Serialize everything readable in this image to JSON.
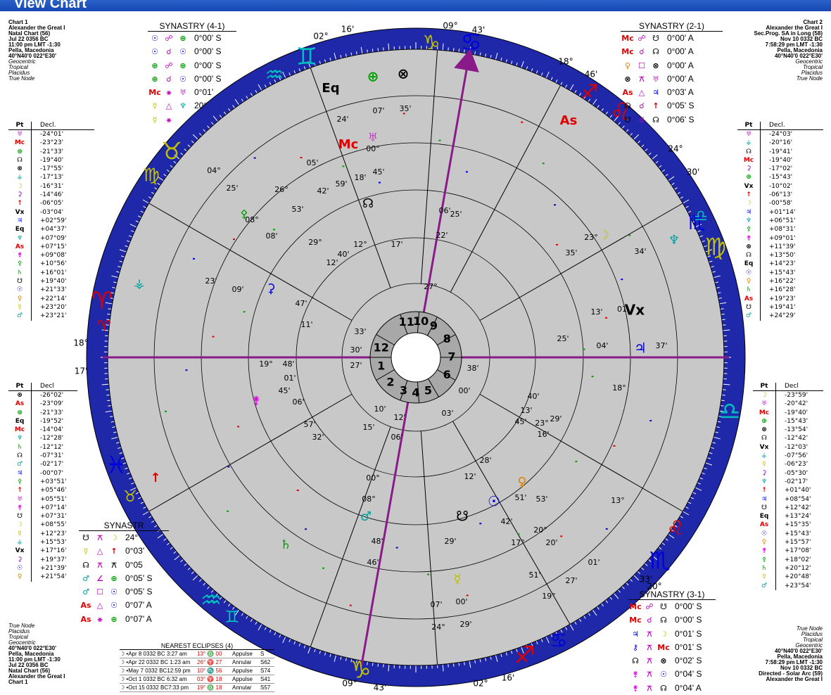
{
  "window": {
    "title": "View Chart"
  },
  "chart1": {
    "lines": [
      "Chart 1",
      "Alexander the Great I",
      "Natal Chart (56)",
      "Jul 22 0356 BC",
      "11:00 pm  LMT -1:30",
      "Pella, Macedonia",
      "40°N40'0 022°E30'",
      "Geocentric",
      "Tropical",
      "Placidus",
      "True Node"
    ]
  },
  "chart2": {
    "lines": [
      "Chart 2",
      "Alexander the Great I",
      "Sec.Prog. SA in Long (58)",
      "Nov 10 0332 BC",
      "7:58:29 pm  LMT -1:30",
      "Pella, Macedonia",
      "40°N40'0 022°E30'",
      "Geocentric",
      "Tropical",
      "Placidus",
      "True Node"
    ]
  },
  "chart1_bottom": {
    "lines": [
      "True Node",
      "Placidus",
      "Tropical",
      "Geocentric",
      "40°N40'0 022°E30'",
      "Pella, Macedonia",
      "11:00 pm  LMT -1:30",
      "Jul 22 0356 BC",
      "Natal Chart (56)",
      "Alexander the Great I",
      "Chart 1"
    ]
  },
  "chart3_bottom": {
    "lines": [
      "True Node",
      "Placidus",
      "Tropical",
      "Geocentric",
      "40°N40'0 022°E30'",
      "Pella, Macedonia",
      "7:58:29 pm  LMT -1:30",
      "Nov 10 0332 BC",
      "Directed - Solar Arc (59)",
      "Alexander the Great I"
    ]
  },
  "decl_left_top": {
    "h1": "Pt",
    "h2": "Decl.",
    "rows": [
      [
        "♅",
        "-24°01'",
        "#c040c0"
      ],
      [
        "Mc",
        "-23°23'",
        "#e00000"
      ],
      [
        "⊕",
        "-21°33'",
        "#00a000"
      ],
      [
        "☊",
        "-19°40'",
        "#000"
      ],
      [
        "⊗",
        "-17°55'",
        "#000"
      ],
      [
        "⚶",
        "-17°13'",
        "#00a0a0"
      ],
      [
        "☽",
        "-16°31'",
        "#c0c000"
      ],
      [
        "⚳",
        "-14°46'",
        "#8000c0"
      ],
      [
        "↑",
        "-06°05'",
        "#e00000"
      ],
      [
        "Vx",
        "-03°04'",
        "#000"
      ],
      [
        "♃",
        "+02°59'",
        "#0000e0"
      ],
      [
        "Eq",
        "+04°37'",
        "#000"
      ],
      [
        "♆",
        "+07°09'",
        "#00a0a0"
      ],
      [
        "As",
        "+07°15'",
        "#e00000"
      ],
      [
        "⚵",
        "+09°08'",
        "#e000e0"
      ],
      [
        "⚴",
        "+10°56'",
        "#00a000"
      ],
      [
        "♄",
        "+16°01'",
        "#00a000"
      ],
      [
        "☋",
        "+19°40'",
        "#000"
      ],
      [
        "☉",
        "+21°33'",
        "#0000e0"
      ],
      [
        "♀",
        "+22°14'",
        "#e08000"
      ],
      [
        "☿",
        "+23°20'",
        "#c0c000"
      ],
      [
        "♂",
        "+23°21'",
        "#00a0a0"
      ]
    ]
  },
  "decl_right_top": {
    "h1": "Pt",
    "h2": "Decl.",
    "rows": [
      [
        "♅",
        "-24°03'",
        "#c040c0"
      ],
      [
        "⚶",
        "-20°16'",
        "#00a0a0"
      ],
      [
        "☊",
        "-19°41'",
        "#000"
      ],
      [
        "Mc",
        "-19°40'",
        "#e00000"
      ],
      [
        "⚳",
        "-17°02'",
        "#8000c0"
      ],
      [
        "⊕",
        "-15°43'",
        "#00a000"
      ],
      [
        "Vx",
        "-10°02'",
        "#000"
      ],
      [
        "↑",
        "-06°13'",
        "#e00000"
      ],
      [
        "☽",
        "-00°58'",
        "#c0c000"
      ],
      [
        "♃",
        "+01°14'",
        "#0000e0"
      ],
      [
        "♆",
        "+06°51'",
        "#00a0a0"
      ],
      [
        "⚴",
        "+08°31'",
        "#00a000"
      ],
      [
        "⚵",
        "+09°01'",
        "#e000e0"
      ],
      [
        "⊗",
        "+11°39'",
        "#000"
      ],
      [
        "☊",
        "+13°50'",
        "#000"
      ],
      [
        "Eq",
        "+14°23'",
        "#000"
      ],
      [
        "☉",
        "+15°43'",
        "#0000e0"
      ],
      [
        "♀",
        "+16°22'",
        "#e08000"
      ],
      [
        "♄",
        "+16°28'",
        "#00a000"
      ],
      [
        "As",
        "+19°23'",
        "#e00000"
      ],
      [
        "☋",
        "+19°41'",
        "#000"
      ],
      [
        "♂",
        "+24°29'",
        "#00a0a0"
      ]
    ]
  },
  "decl_left_bot": {
    "h1": "Pt",
    "h2": "Decl",
    "rows": [
      [
        "⊗",
        "-26°02'",
        "#000"
      ],
      [
        "As",
        "-23°09'",
        "#e00000"
      ],
      [
        "⊕",
        "-21°33'",
        "#00a000"
      ],
      [
        "Eq",
        "-19°52'",
        "#000"
      ],
      [
        "Mc",
        "-14°04'",
        "#e00000"
      ],
      [
        "♆",
        "-12°28'",
        "#00a0a0"
      ],
      [
        "♄",
        "-12°12'",
        "#00a000"
      ],
      [
        "☊",
        "-07°31'",
        "#000"
      ],
      [
        "♂",
        "-02°17'",
        "#00a0a0"
      ],
      [
        "♃",
        "-00°07'",
        "#0000e0"
      ],
      [
        "⚴",
        "+03°51'",
        "#00a000"
      ],
      [
        "↑",
        "+05°46'",
        "#e00000"
      ],
      [
        "♅",
        "+05°51'",
        "#c040c0"
      ],
      [
        "⚵",
        "+07°14'",
        "#e000e0"
      ],
      [
        "☋",
        "+07°31'",
        "#000"
      ],
      [
        "☽",
        "+08°55'",
        "#c0c000"
      ],
      [
        "☿",
        "+12°23'",
        "#c0c000"
      ],
      [
        "⚶",
        "+15°53'",
        "#00a0a0"
      ],
      [
        "Vx",
        "+17°16'",
        "#000"
      ],
      [
        "⚳",
        "+19°37'",
        "#8000c0"
      ],
      [
        "☉",
        "+21°39'",
        "#0000e0"
      ],
      [
        "♀",
        "+21°54'",
        "#e08000"
      ]
    ]
  },
  "decl_right_bot": {
    "h1": "Pt",
    "h2": "Decl",
    "rows": [
      [
        "☽",
        "-23°59'",
        "#c0c000"
      ],
      [
        "♅",
        "-20°42'",
        "#c040c0"
      ],
      [
        "Mc",
        "-19°40'",
        "#e00000"
      ],
      [
        "⊕",
        "-15°43'",
        "#00a000"
      ],
      [
        "⊗",
        "-13°54'",
        "#000"
      ],
      [
        "☊",
        "-12°42'",
        "#000"
      ],
      [
        "Vx",
        "-12°03'",
        "#000"
      ],
      [
        "⚶",
        "-07°56'",
        "#00a0a0"
      ],
      [
        "☿",
        "-06°23'",
        "#c0c000"
      ],
      [
        "⚳",
        "-05°30'",
        "#8000c0"
      ],
      [
        "♆",
        "-02°17'",
        "#00a0a0"
      ],
      [
        "↑",
        "+01°40'",
        "#e00000"
      ],
      [
        "♃",
        "+08°54'",
        "#0000e0"
      ],
      [
        "☋",
        "+12°42'",
        "#000"
      ],
      [
        "Eq",
        "+13°24'",
        "#000"
      ],
      [
        "As",
        "+15°35'",
        "#e00000"
      ],
      [
        "☉",
        "+15°43'",
        "#0000e0"
      ],
      [
        "♀",
        "+15°57'",
        "#e08000"
      ],
      [
        "⚵",
        "+17°08'",
        "#e000e0"
      ],
      [
        "⚴",
        "+18°02'",
        "#00a000"
      ],
      [
        "♄",
        "+20°12'",
        "#00a000"
      ],
      [
        "☿",
        "+20°48'",
        "#c0c000"
      ],
      [
        "♂",
        "+23°54'",
        "#00a0a0"
      ]
    ]
  },
  "syn41": {
    "title": "SYNASTRY (4-1)",
    "rows": [
      [
        "☉",
        "☍",
        "⊕",
        "0°00' S"
      ],
      [
        "☉",
        "☌",
        "☉",
        "0°00' S"
      ],
      [
        "⊕",
        "☍",
        "⊕",
        "0°00' S"
      ],
      [
        "⊕",
        "☌",
        "☉",
        "0°00' S"
      ],
      [
        "Mc",
        "⚹",
        "♅",
        "0°01' "
      ],
      [
        "☿",
        "△",
        "♆",
        "20°"
      ],
      [
        "☿",
        "⚹",
        "",
        ""
      ]
    ]
  },
  "syn21": {
    "title": "SYNASTRY (2-1)",
    "rows": [
      [
        "Mc",
        "☍",
        "☋",
        "0°00' A"
      ],
      [
        "Mc",
        "☌",
        "☊",
        "0°00' A"
      ],
      [
        "♀",
        "☐",
        "⊗",
        "0°00' A"
      ],
      [
        "⊗",
        "⚻",
        "♅",
        "0°00' A"
      ],
      [
        "As",
        "△",
        "♃",
        "0°03' A"
      ],
      [
        "☊",
        "☌",
        "↑",
        "0°05' S"
      ],
      [
        "☋",
        "☌",
        "☊",
        "0°06' S"
      ]
    ]
  },
  "syn_left": {
    "title": "SYNASTR",
    "rows": [
      [
        "☋",
        "⚻",
        "☽",
        "24°"
      ],
      [
        "☿",
        "△",
        "↑",
        "0°03'"
      ],
      [
        "☊",
        "⚻",
        "⚻",
        "0°05"
      ],
      [
        "♂",
        "∠",
        "⊕",
        "0°05' S"
      ],
      [
        "♂",
        "☐",
        "☉",
        "0°05' S"
      ],
      [
        "As",
        "△",
        "☉",
        "0°07' A"
      ],
      [
        "As",
        "⚹",
        "⊕",
        "0°07' A"
      ]
    ]
  },
  "syn31": {
    "title": "SYNASTRY (3-1)",
    "rows": [
      [
        "Mc",
        "☍",
        "☋",
        "0°00' S"
      ],
      [
        "Mc",
        "☌",
        "☊",
        "0°00' S"
      ],
      [
        "♃",
        "⚻",
        "☽",
        "0°01' S"
      ],
      [
        "⚷",
        "⚻",
        "Mc",
        "0°01' S"
      ],
      [
        "☊",
        "⚻",
        "⊗",
        "0°02' S"
      ],
      [
        "⚵",
        "⚻",
        "☉",
        "0°04' S"
      ],
      [
        "⚵",
        "⚻",
        "☊",
        "0°04' A"
      ]
    ]
  },
  "eclipses": {
    "title": "NEAREST ECLIPSES (4)",
    "rows": [
      [
        "☽ •Apr 8 0332 BC 3:27 am",
        "13° ♎ 00",
        "Appulse",
        "S"
      ],
      [
        "☽ •Apr 22 0332 BC 1:23 am",
        "26° ♈ 27",
        "Annular",
        "S62"
      ],
      [
        "☽ •May 7 0332 BC12:59 pm",
        "10° ♏ 56",
        "Appulse",
        "S74"
      ],
      [
        "☽ •Oct 1 0332 BC 6:32 am",
        "03° ♈ 18",
        "Appulse",
        "S41"
      ],
      [
        "☽ •Oct 15 0332 BC7:33 pm",
        "19° ♎ 18",
        "Annular",
        "S57"
      ]
    ]
  },
  "wheel": {
    "signs": [
      {
        "glyph": "♈",
        "color": "#e00000"
      },
      {
        "glyph": "♉",
        "color": "#c0c000"
      },
      {
        "glyph": "♊",
        "color": "#00c0c0"
      },
      {
        "glyph": "♋",
        "color": "#0000e0"
      },
      {
        "glyph": "♌",
        "color": "#e00000"
      },
      {
        "glyph": "♍",
        "color": "#c0c000"
      },
      {
        "glyph": "♎",
        "color": "#00c0c0"
      },
      {
        "glyph": "♏",
        "color": "#0000e0"
      },
      {
        "glyph": "♐",
        "color": "#e00000"
      },
      {
        "glyph": "♑",
        "color": "#c0c000"
      },
      {
        "glyph": "♒",
        "color": "#00c0c0"
      },
      {
        "glyph": "♓",
        "color": "#0000e0"
      }
    ],
    "houses": [
      "1",
      "2",
      "3",
      "4",
      "5",
      "6",
      "7",
      "8",
      "9",
      "10",
      "11",
      "12"
    ],
    "cusp_labels": [
      "09°",
      "43'",
      "18°",
      "46'",
      "24°",
      "30'",
      "02°",
      "16'",
      "02°",
      "16'",
      "09°",
      "43'",
      "18°",
      "17'",
      "20°",
      "33'"
    ],
    "glyphs": [
      {
        "t": "♑",
        "c": "#c0c000"
      },
      {
        "t": "♒",
        "c": "#00c0c0"
      },
      {
        "t": "♐",
        "c": "#e00000"
      },
      {
        "t": "♏",
        "c": "#0000e0"
      },
      {
        "t": "Eq",
        "c": "#000"
      },
      {
        "t": "⊕",
        "c": "#00a000"
      },
      {
        "t": "⊗",
        "c": "#000"
      },
      {
        "t": "Mc",
        "c": "#e00000"
      },
      {
        "t": "♅",
        "c": "#c040c0"
      },
      {
        "t": "☊",
        "c": "#000"
      },
      {
        "t": "As",
        "c": "#e00000"
      },
      {
        "t": "☽",
        "c": "#c0c000"
      },
      {
        "t": "♆",
        "c": "#00a0a0"
      },
      {
        "t": "Vx",
        "c": "#000"
      },
      {
        "t": "♃",
        "c": "#0000e0"
      },
      {
        "t": "☉",
        "c": "#0000e0"
      },
      {
        "t": "♀",
        "c": "#e08000"
      },
      {
        "t": "☋",
        "c": "#000"
      },
      {
        "t": "♂",
        "c": "#00a0a0"
      },
      {
        "t": "☿",
        "c": "#c0c000"
      },
      {
        "t": "♄",
        "c": "#00a000"
      },
      {
        "t": "⚴",
        "c": "#00a000"
      },
      {
        "t": "⚵",
        "c": "#e000e0"
      },
      {
        "t": "⚳",
        "c": "#0000e0"
      },
      {
        "t": "↑",
        "c": "#e00000"
      },
      {
        "t": "⚶",
        "c": "#00a0a0"
      },
      {
        "t": "♈",
        "c": "#e00000"
      },
      {
        "t": "♉",
        "c": "#c0c000"
      },
      {
        "t": "♊",
        "c": "#00c0c0"
      },
      {
        "t": "♋",
        "c": "#0000e0"
      },
      {
        "t": "♌",
        "c": "#e00000"
      },
      {
        "t": "♍",
        "c": "#c0c000"
      },
      {
        "t": "♎",
        "c": "#00c0c0"
      }
    ],
    "values": [
      "24'",
      "07'",
      "35'",
      "00°",
      "05'",
      "59'",
      "18'",
      "45'",
      "53'",
      "42'",
      "26°",
      "06'",
      "22'",
      "12'",
      "04°",
      "25'",
      "08°",
      "08'",
      "29°",
      "40'",
      "12°",
      "17'",
      "27°",
      "23'",
      "09'",
      "47'",
      "11'",
      "33'",
      "30'",
      "27'",
      "19°",
      "48'",
      "01'",
      "45'",
      "06'",
      "57'",
      "32'",
      "10'",
      "15'",
      "06'",
      "12'",
      "28'",
      "51'",
      "27'",
      "19°",
      "20'",
      "01'",
      "07'",
      "00'",
      "29'",
      "24°",
      "29'",
      "48'",
      "46'",
      "08°",
      "00°",
      "25'",
      "34'",
      "35'",
      "23°",
      "13'",
      "01",
      "38'",
      "00'",
      "04'",
      "37'",
      "18°",
      "25'",
      "40'",
      "13'",
      "45'",
      "16'",
      "23°",
      "29'",
      "03'",
      "12'",
      "13°",
      "51'",
      "53'",
      "42'",
      "20°",
      "17°"
    ]
  }
}
